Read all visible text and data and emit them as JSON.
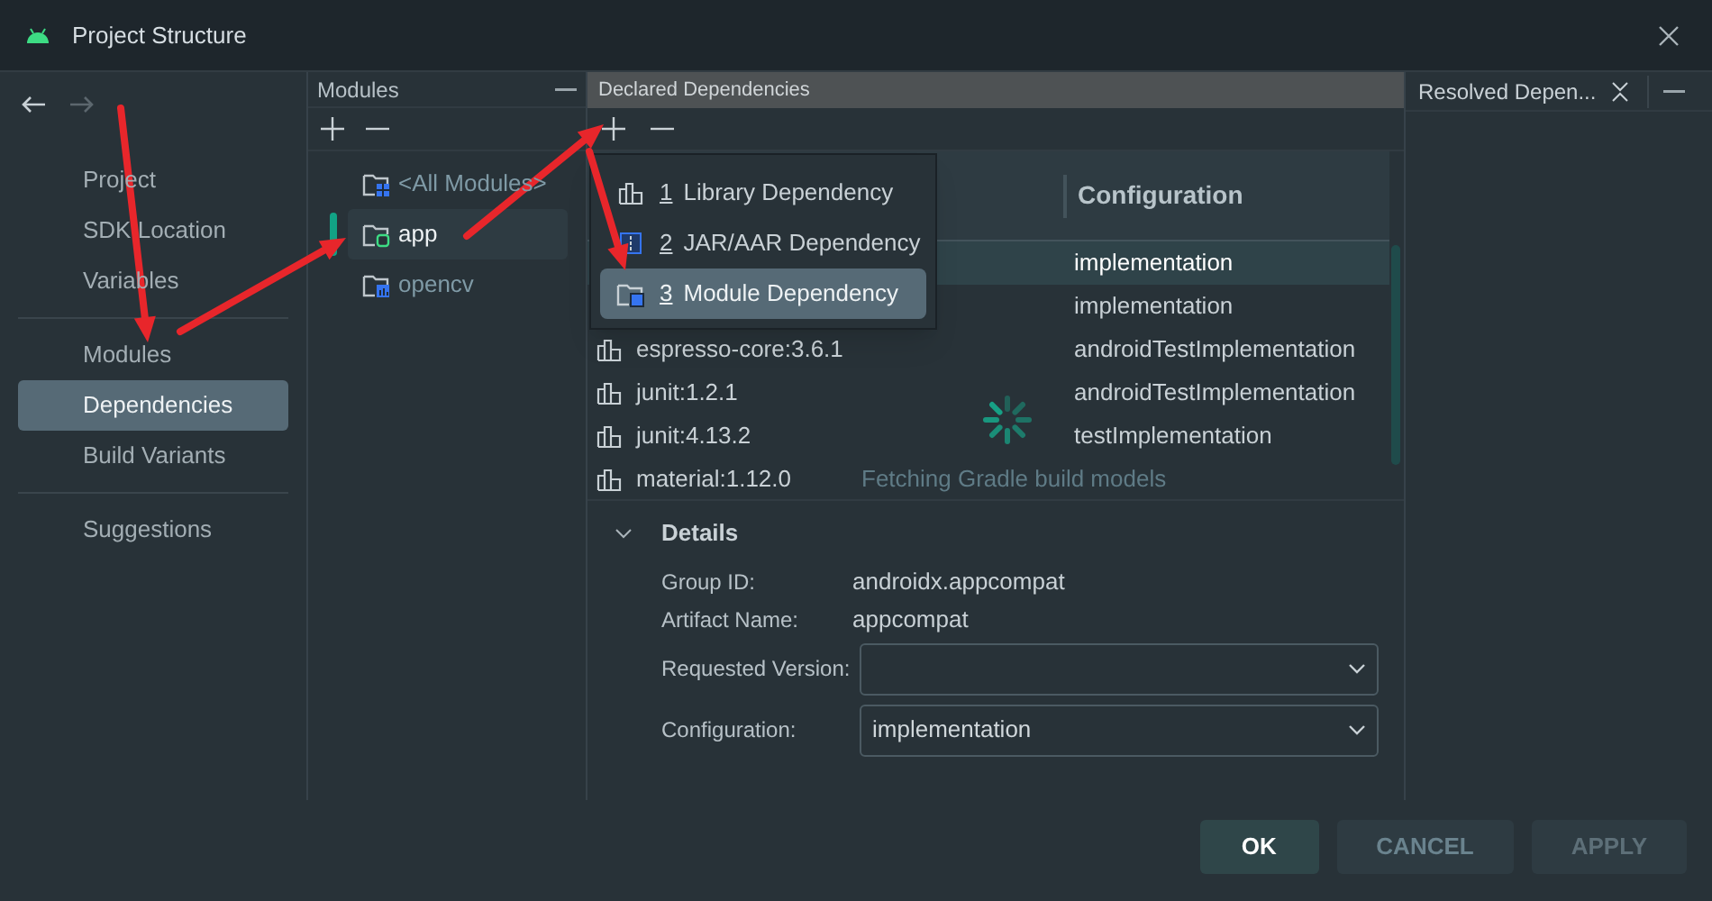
{
  "window": {
    "title": "Project Structure"
  },
  "sidebar": {
    "groups": [
      [
        {
          "label": "Project",
          "selected": false
        },
        {
          "label": "SDK Location",
          "selected": false
        },
        {
          "label": "Variables",
          "selected": false
        }
      ],
      [
        {
          "label": "Modules",
          "selected": false
        },
        {
          "label": "Dependencies",
          "selected": true
        },
        {
          "label": "Build Variants",
          "selected": false
        }
      ],
      [
        {
          "label": "Suggestions",
          "selected": false
        }
      ]
    ]
  },
  "modules": {
    "title": "Modules",
    "items": [
      {
        "label": "<All Modules>",
        "kind": "all",
        "selected": false
      },
      {
        "label": "app",
        "kind": "app",
        "selected": true
      },
      {
        "label": "opencv",
        "kind": "library",
        "selected": false
      }
    ]
  },
  "declared": {
    "title": "Declared Dependencies",
    "add_menu": [
      {
        "number": "1",
        "label": "Library Dependency",
        "kind": "library",
        "selected": false
      },
      {
        "number": "2",
        "label": "JAR/AAR Dependency",
        "kind": "jar",
        "selected": false
      },
      {
        "number": "3",
        "label": "Module Dependency",
        "kind": "module",
        "selected": true
      }
    ],
    "table": {
      "columns": [
        "Configuration"
      ],
      "rows": [
        {
          "configuration": "implementation",
          "selected": true
        },
        {
          "configuration": "implementation",
          "selected": false
        },
        {
          "name": "espresso-core:3.6.1",
          "configuration": "androidTestImplementation",
          "selected": false
        },
        {
          "name": "junit:1.2.1",
          "configuration": "androidTestImplementation",
          "selected": false
        },
        {
          "name": "junit:4.13.2",
          "configuration": "testImplementation",
          "selected": false
        },
        {
          "name": "material:1.12.0",
          "selected": false
        }
      ]
    },
    "loading": "Fetching Gradle build models",
    "details": {
      "title": "Details",
      "expanded": true,
      "fields": [
        {
          "kind": "text",
          "label": "Group ID:",
          "value": "androidx.appcompat"
        },
        {
          "kind": "text",
          "label": "Artifact Name:",
          "value": "appcompat"
        },
        {
          "kind": "dropdown",
          "label": "Requested Version:"
        },
        {
          "kind": "dropdown",
          "label": "Configuration:",
          "value": "implementation"
        }
      ]
    }
  },
  "resolved": {
    "title": "Resolved Depen..."
  },
  "buttons": [
    {
      "label": "OK",
      "kind": "primary",
      "disabled": false
    },
    {
      "label": "CANCEL",
      "kind": "normal",
      "disabled": false
    },
    {
      "label": "APPLY",
      "kind": "normal",
      "disabled": true
    }
  ]
}
